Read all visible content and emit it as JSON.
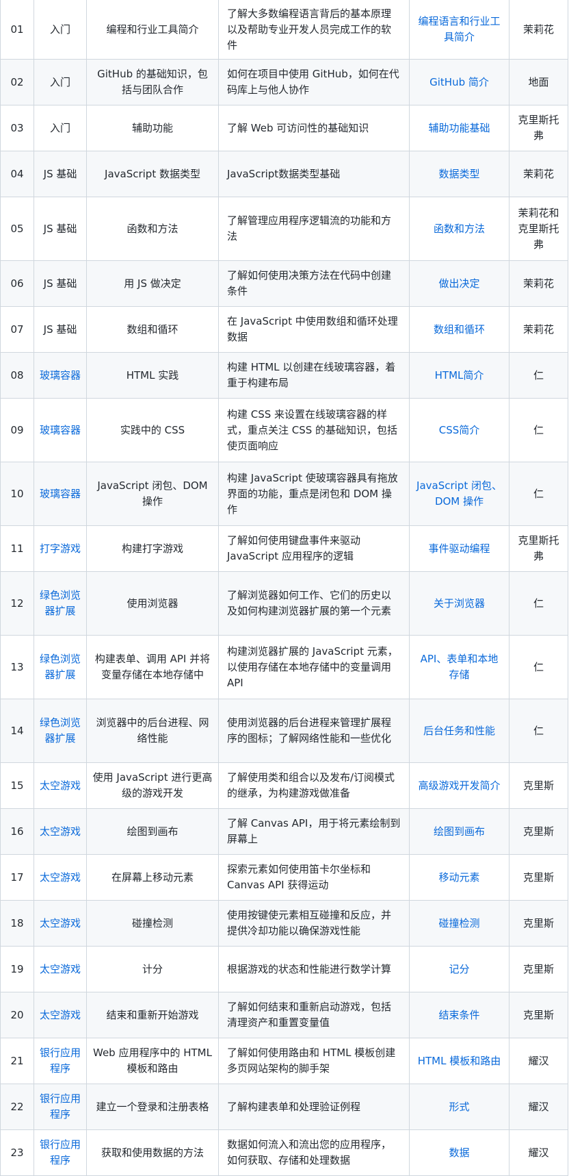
{
  "colors": {
    "link": "#0969da",
    "border": "#d0d7de",
    "stripe": "#f6f8fa",
    "text": "#24292f"
  },
  "rows": [
    {
      "num": "01",
      "category": "入门",
      "category_link": false,
      "topic": "编程和行业工具简介",
      "description": "了解大多数编程语言背后的基本原理以及帮助专业开发人员完成工作的软件",
      "lesson": "编程语言和行业工具简介",
      "author": "茉莉花"
    },
    {
      "num": "02",
      "category": "入门",
      "category_link": false,
      "topic": "GitHub 的基础知识，包括与团队合作",
      "description": "如何在项目中使用 GitHub，如何在代码库上与他人协作",
      "lesson": "GitHub 简介",
      "author": "地面"
    },
    {
      "num": "03",
      "category": "入门",
      "category_link": false,
      "topic": "辅助功能",
      "description": "了解 Web 可访问性的基础知识",
      "lesson": "辅助功能基础",
      "author": "克里斯托弗"
    },
    {
      "num": "04",
      "category": "JS 基础",
      "category_link": false,
      "topic": "JavaScript 数据类型",
      "description": "JavaScript数据类型基础",
      "lesson": "数据类型",
      "author": "茉莉花"
    },
    {
      "num": "05",
      "category": "JS 基础",
      "category_link": false,
      "topic": "函数和方法",
      "description": "了解管理应用程序逻辑流的功能和方法",
      "lesson": "函数和方法",
      "author": "茉莉花和克里斯托弗"
    },
    {
      "num": "06",
      "category": "JS 基础",
      "category_link": false,
      "topic": "用 JS 做决定",
      "description": "了解如何使用决策方法在代码中创建条件",
      "lesson": "做出决定",
      "author": "茉莉花"
    },
    {
      "num": "07",
      "category": "JS 基础",
      "category_link": false,
      "topic": "数组和循环",
      "description": "在 JavaScript 中使用数组和循环处理数据",
      "lesson": "数组和循环",
      "author": "茉莉花"
    },
    {
      "num": "08",
      "category": "玻璃容器",
      "category_link": true,
      "topic": "HTML 实践",
      "description": "构建 HTML 以创建在线玻璃容器，着重于构建布局",
      "lesson": "HTML简介",
      "author": "仁"
    },
    {
      "num": "09",
      "category": "玻璃容器",
      "category_link": true,
      "topic": "实践中的 CSS",
      "description": "构建 CSS 来设置在线玻璃容器的样式，重点关注 CSS 的基础知识，包括使页面响应",
      "lesson": "CSS简介",
      "author": "仁"
    },
    {
      "num": "10",
      "category": "玻璃容器",
      "category_link": true,
      "topic": "JavaScript 闭包、DOM 操作",
      "description": "构建 JavaScript 使玻璃容器具有拖放界面的功能，重点是闭包和 DOM 操作",
      "lesson": "JavaScript 闭包、DOM 操作",
      "author": "仁"
    },
    {
      "num": "11",
      "category": "打字游戏",
      "category_link": true,
      "topic": "构建打字游戏",
      "description": "了解如何使用键盘事件来驱动 JavaScript 应用程序的逻辑",
      "lesson": "事件驱动编程",
      "author": "克里斯托弗"
    },
    {
      "num": "12",
      "category": "绿色浏览器扩展",
      "category_link": true,
      "topic": "使用浏览器",
      "description": "了解浏览器如何工作、它们的历史以及如何构建浏览器扩展的第一个元素",
      "lesson": "关于浏览器",
      "author": "仁"
    },
    {
      "num": "13",
      "category": "绿色浏览器扩展",
      "category_link": true,
      "topic": "构建表单、调用 API 并将变量存储在本地存储中",
      "description": "构建浏览器扩展的 JavaScript 元素，以使用存储在本地存储中的变量调用 API",
      "lesson": "API、表单和本地存储",
      "author": "仁"
    },
    {
      "num": "14",
      "category": "绿色浏览器扩展",
      "category_link": true,
      "topic": "浏览器中的后台进程、网络性能",
      "description": "使用浏览器的后台进程来管理扩展程序的图标；了解网络性能和一些优化",
      "lesson": "后台任务和性能",
      "author": "仁"
    },
    {
      "num": "15",
      "category": "太空游戏",
      "category_link": true,
      "topic": "使用 JavaScript 进行更高级的游戏开发",
      "description": "了解使用类和组合以及发布/订阅模式的继承，为构建游戏做准备",
      "lesson": "高级游戏开发简介",
      "author": "克里斯"
    },
    {
      "num": "16",
      "category": "太空游戏",
      "category_link": true,
      "topic": "绘图到画布",
      "description": "了解 Canvas API，用于将元素绘制到屏幕上",
      "lesson": "绘图到画布",
      "author": "克里斯"
    },
    {
      "num": "17",
      "category": "太空游戏",
      "category_link": true,
      "topic": "在屏幕上移动元素",
      "description": "探索元素如何使用笛卡尔坐标和 Canvas API 获得运动",
      "lesson": "移动元素",
      "author": "克里斯"
    },
    {
      "num": "18",
      "category": "太空游戏",
      "category_link": true,
      "topic": "碰撞检测",
      "description": "使用按键使元素相互碰撞和反应，并提供冷却功能以确保游戏性能",
      "lesson": "碰撞检测",
      "author": "克里斯"
    },
    {
      "num": "19",
      "category": "太空游戏",
      "category_link": true,
      "topic": "计分",
      "description": "根据游戏的状态和性能进行数学计算",
      "lesson": "记分",
      "author": "克里斯"
    },
    {
      "num": "20",
      "category": "太空游戏",
      "category_link": true,
      "topic": "结束和重新开始游戏",
      "description": "了解如何结束和重新启动游戏，包括清理资产和重置变量值",
      "lesson": "结束条件",
      "author": "克里斯"
    },
    {
      "num": "21",
      "category": "银行应用程序",
      "category_link": true,
      "topic": "Web 应用程序中的 HTML 模板和路由",
      "description": "了解如何使用路由和 HTML 模板创建多页网站架构的脚手架",
      "lesson": "HTML 模板和路由",
      "author": "耀汉"
    },
    {
      "num": "22",
      "category": "银行应用程序",
      "category_link": true,
      "topic": "建立一个登录和注册表格",
      "description": "了解构建表单和处理验证例程",
      "lesson": "形式",
      "author": "耀汉"
    },
    {
      "num": "23",
      "category": "银行应用程序",
      "category_link": true,
      "topic": "获取和使用数据的方法",
      "description": "数据如何流入和流出您的应用程序，如何获取、存储和处理数据",
      "lesson": "数据",
      "author": "耀汉"
    }
  ]
}
